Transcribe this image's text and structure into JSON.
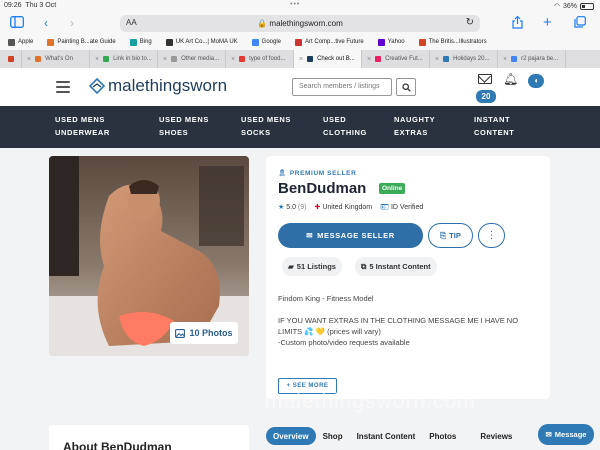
{
  "status_bar": {
    "time": "09:26",
    "date": "Thu 3 Oct",
    "battery": "36%"
  },
  "browser": {
    "text_size_label": "AA",
    "url": "malethingsworn.com",
    "bookmarks": [
      {
        "label": "Apple",
        "color": "#555555"
      },
      {
        "label": "Painting B...ate Guide",
        "color": "#e0732b"
      },
      {
        "label": "Bing",
        "color": "#1aa0a0"
      },
      {
        "label": "UK Art Co...| MoMA UK",
        "color": "#333333"
      },
      {
        "label": "Google",
        "color": "#4285f4"
      },
      {
        "label": "Art Comp...tive Future",
        "color": "#c33"
      },
      {
        "label": "Yahoo",
        "color": "#6001d2"
      },
      {
        "label": "The Britis...Illustrators",
        "color": "#d04424"
      }
    ],
    "tabs": [
      {
        "label": "What's On",
        "color": "#e0732b",
        "active": false
      },
      {
        "label": "Link in bio to...",
        "color": "#34a853",
        "active": false
      },
      {
        "label": "Other media...",
        "color": "#999999",
        "active": false
      },
      {
        "label": "type of food...",
        "color": "#e53935",
        "active": false
      },
      {
        "label": "Check out B...",
        "color": "#1e3d5c",
        "active": true
      },
      {
        "label": "Creative Fut...",
        "color": "#e91e63",
        "active": false
      },
      {
        "label": "Holidays 20...",
        "color": "#2f79b5",
        "active": false
      },
      {
        "label": "r2 pajara be...",
        "color": "#4285f4",
        "active": false
      }
    ]
  },
  "site": {
    "logo_text": "malethingsworn",
    "search_placeholder": "Search members / listings",
    "notification_count": "20",
    "nav": [
      {
        "line1": "USED MENS",
        "line2": "UNDERWEAR"
      },
      {
        "line1": "USED MENS",
        "line2": "SHOES"
      },
      {
        "line1": "USED MENS",
        "line2": "SOCKS"
      },
      {
        "line1": "USED",
        "line2": "CLOTHING"
      },
      {
        "line1": "NAUGHTY",
        "line2": "EXTRAS"
      },
      {
        "line1": "INSTANT",
        "line2": "CONTENT"
      }
    ]
  },
  "profile": {
    "photo_count": "10 Photos",
    "seller_tier": "PREMIUM SELLER",
    "name": "BenDudman",
    "status": "Online",
    "rating": "5.0",
    "rating_count": "(9)",
    "country": "United Kingdom",
    "id_status": "ID Verified",
    "message_label": "MESSAGE SELLER",
    "tip_label": "TIP",
    "listings": "51 Listings",
    "instant_content": "5 Instant Content",
    "bio": [
      "Findom King - Fitness Model",
      "IF YOU WANT EXTRAS IN THE CLOTHING MESSAGE ME I HAVE NO LIMITS 💦 💛 (prices will vary)",
      "-Custom photo/video requests available"
    ],
    "see_more_label": "+ SEE MORE"
  },
  "watermark": "malethingsworn.com",
  "about_title": "About BenDudman",
  "profile_tabs": [
    {
      "label": "Overview",
      "active": true
    },
    {
      "label": "Shop",
      "active": false
    },
    {
      "label": "Instant Content",
      "active": false
    },
    {
      "label": "Photos",
      "active": false
    },
    {
      "label": "Reviews",
      "active": false
    }
  ],
  "floating_message_label": "Message",
  "colors": {
    "brand": "#2f79b5",
    "nav_bg": "#2a323f",
    "online": "#3bab5a",
    "logo": "#1e3d5c"
  }
}
